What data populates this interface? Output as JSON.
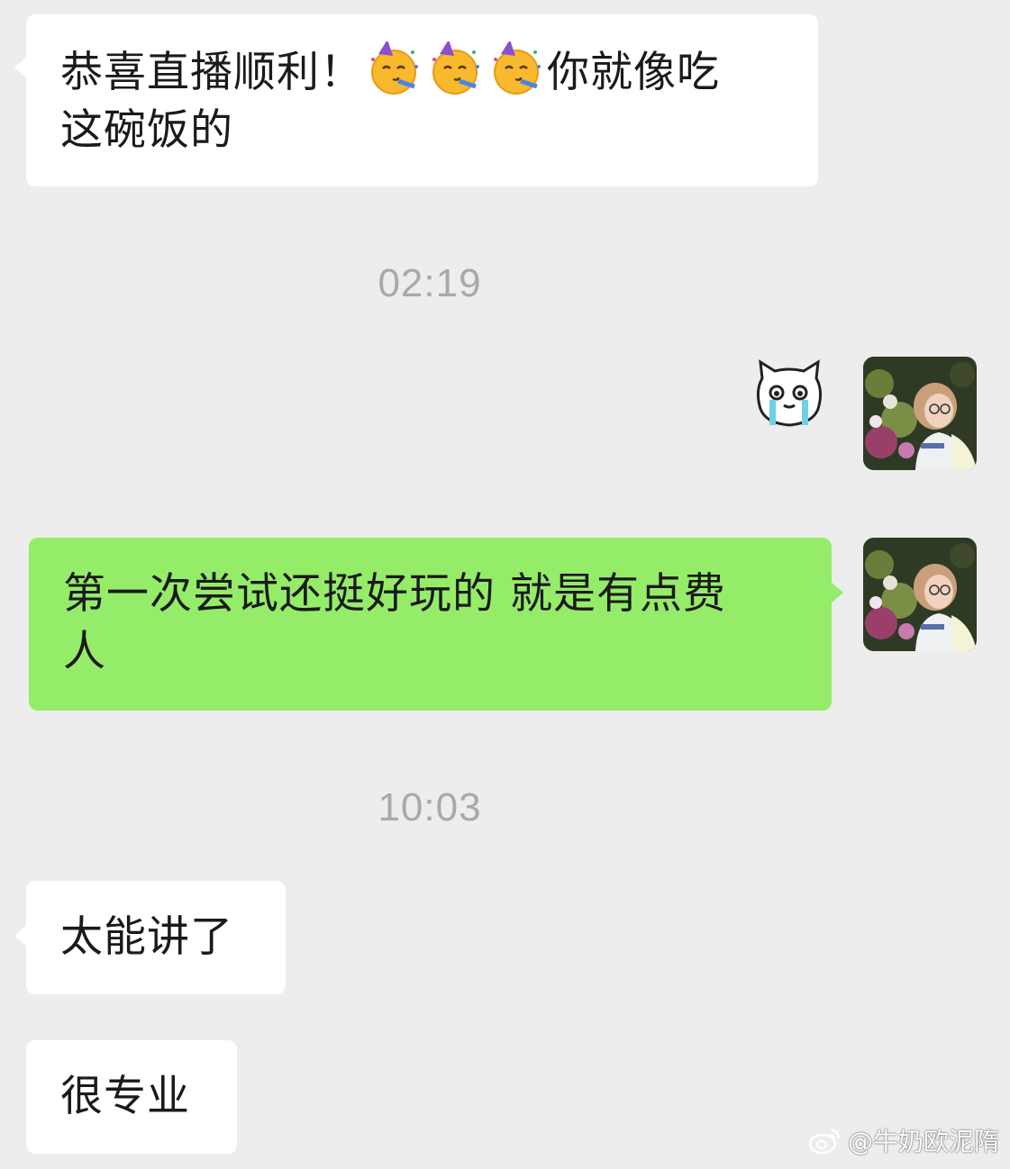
{
  "messages": {
    "m1": {
      "text_a": "恭喜直播顺利！",
      "emojis": [
        "partying-face",
        "partying-face",
        "partying-face"
      ],
      "text_b": "你就像吃",
      "text_c": "这碗饭的"
    },
    "time1": "02:19",
    "m2": {
      "sticker": "crying-cat-sticker"
    },
    "m3": {
      "line1": "第一次尝试还挺好玩的 就是有点费",
      "line2": "人"
    },
    "time2": "10:03",
    "m4": "太能讲了",
    "m5": "很专业"
  },
  "colors": {
    "background": "#ededed",
    "received_bubble": "#ffffff",
    "sent_bubble": "#95ec69",
    "timestamp": "#a9a9a9"
  },
  "watermark": {
    "text": "@牛奶欧泥隋"
  }
}
